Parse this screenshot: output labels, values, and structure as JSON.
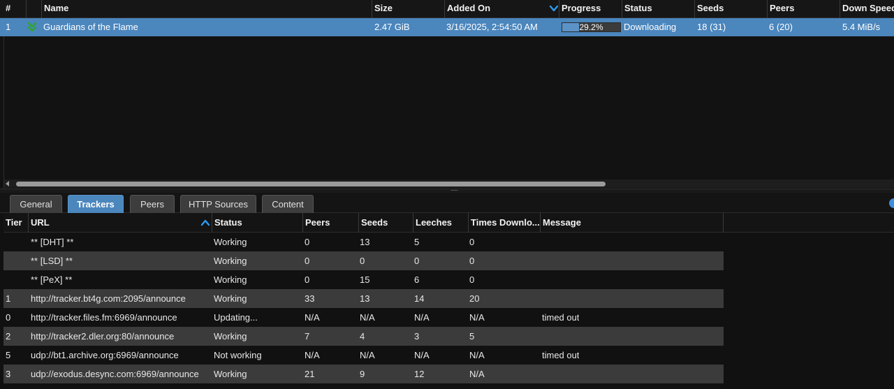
{
  "torrents": {
    "columns": {
      "num": "#",
      "name": "Name",
      "size": "Size",
      "added_on": "Added On",
      "progress": "Progress",
      "status": "Status",
      "seeds": "Seeds",
      "peers": "Peers",
      "down_speed": "Down Speed"
    },
    "sort_indicator_icon": "chevron-down-icon",
    "rows": [
      {
        "num": "1",
        "status_icon": "downloading-double-chevron-icon",
        "name": "Guardians of the Flame",
        "size": "2.47 GiB",
        "added_on": "3/16/2025, 2:54:50 AM",
        "progress_text": "29.2%",
        "progress_value": 0.292,
        "status": "Downloading",
        "seeds": "18 (31)",
        "peers": "6 (20)",
        "down_speed": "5.4 MiB/s"
      }
    ]
  },
  "tabs": [
    {
      "label": "General",
      "active": false
    },
    {
      "label": "Trackers",
      "active": true
    },
    {
      "label": "Peers",
      "active": false
    },
    {
      "label": "HTTP Sources",
      "active": false
    },
    {
      "label": "Content",
      "active": false
    }
  ],
  "trackers": {
    "columns": {
      "tier": "Tier",
      "url": "URL",
      "status": "Status",
      "peers": "Peers",
      "seeds": "Seeds",
      "leeches": "Leeches",
      "times_downloaded": "Times Downlo...",
      "message": "Message"
    },
    "sort_indicator_icon": "chevron-up-icon",
    "rows": [
      {
        "tier": "",
        "url": "** [DHT] **",
        "status": "Working",
        "peers": "0",
        "seeds": "13",
        "leeches": "5",
        "times_downloaded": "0",
        "message": ""
      },
      {
        "tier": "",
        "url": "** [LSD] **",
        "status": "Working",
        "peers": "0",
        "seeds": "0",
        "leeches": "0",
        "times_downloaded": "0",
        "message": ""
      },
      {
        "tier": "",
        "url": "** [PeX] **",
        "status": "Working",
        "peers": "0",
        "seeds": "15",
        "leeches": "6",
        "times_downloaded": "0",
        "message": ""
      },
      {
        "tier": "1",
        "url": "http://tracker.bt4g.com:2095/announce",
        "status": "Working",
        "peers": "33",
        "seeds": "13",
        "leeches": "14",
        "times_downloaded": "20",
        "message": ""
      },
      {
        "tier": "0",
        "url": "http://tracker.files.fm:6969/announce",
        "status": "Updating...",
        "peers": "N/A",
        "seeds": "N/A",
        "leeches": "N/A",
        "times_downloaded": "N/A",
        "message": "timed out"
      },
      {
        "tier": "2",
        "url": "http://tracker2.dler.org:80/announce",
        "status": "Working",
        "peers": "7",
        "seeds": "4",
        "leeches": "3",
        "times_downloaded": "5",
        "message": ""
      },
      {
        "tier": "5",
        "url": "udp://bt1.archive.org:6969/announce",
        "status": "Not working",
        "peers": "N/A",
        "seeds": "N/A",
        "leeches": "N/A",
        "times_downloaded": "N/A",
        "message": "timed out"
      },
      {
        "tier": "3",
        "url": "udp://exodus.desync.com:6969/announce",
        "status": "Working",
        "peers": "21",
        "seeds": "9",
        "leeches": "12",
        "times_downloaded": "N/A",
        "message": ""
      }
    ]
  },
  "colors": {
    "selection": "#4b86bd",
    "accent_icon": "#2e9bf0",
    "downloading_icon": "#2fa52f",
    "background": "#111111",
    "alt_row": "#3b3b3b"
  }
}
